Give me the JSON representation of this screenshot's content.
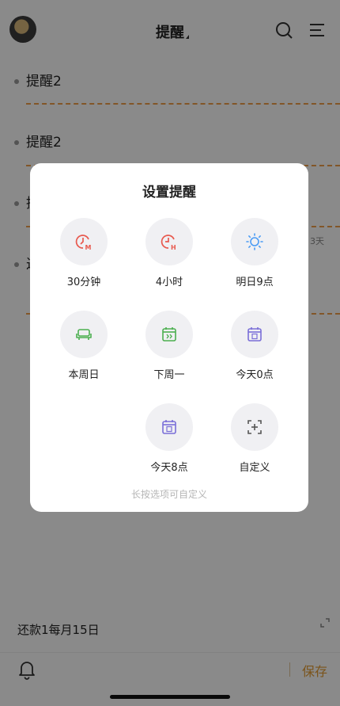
{
  "header": {
    "title": "提醒"
  },
  "list": {
    "items": [
      "提醒2",
      "提醒2",
      "提",
      "过"
    ],
    "side_text": "3天"
  },
  "modal": {
    "title": "设置提醒",
    "options": [
      {
        "label": "30分钟",
        "icon": "clock-m-icon",
        "color": "#e85a4f"
      },
      {
        "label": "4小时",
        "icon": "clock-h-icon",
        "color": "#e85a4f"
      },
      {
        "label": "明日9点",
        "icon": "sun-icon",
        "color": "#4b9cf5"
      },
      {
        "label": "本周日",
        "icon": "sofa-icon",
        "color": "#4caf50"
      },
      {
        "label": "下周一",
        "icon": "calendar-next-icon",
        "color": "#4caf50"
      },
      {
        "label": "今天0点",
        "icon": "calendar-today-icon",
        "color": "#7a6fd8"
      },
      {
        "label": "今天8点",
        "icon": "calendar-today-icon",
        "color": "#7a6fd8"
      },
      {
        "label": "自定义",
        "icon": "custom-add-icon",
        "color": "#555555"
      }
    ],
    "hint": "长按选项可自定义"
  },
  "composer": {
    "text": "还款1每月15日",
    "save_label": "保存"
  }
}
